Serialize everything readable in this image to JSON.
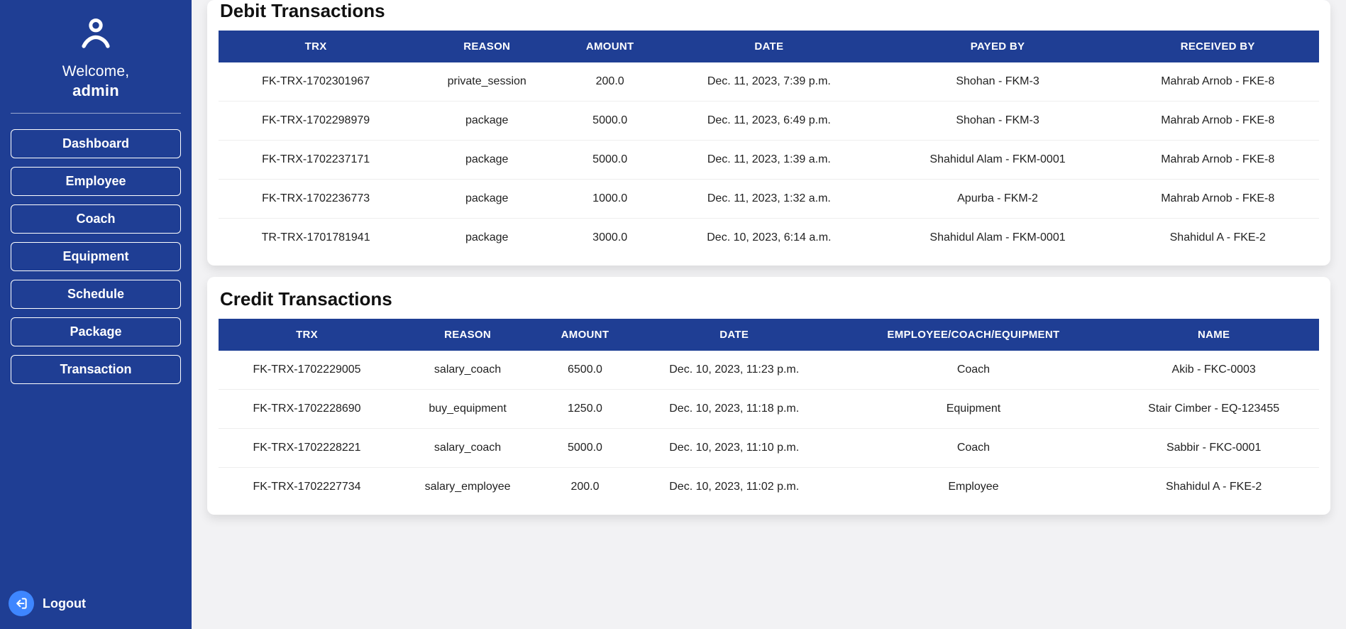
{
  "sidebar": {
    "welcome": "Welcome,",
    "username": "admin",
    "nav": [
      "Dashboard",
      "Employee",
      "Coach",
      "Equipment",
      "Schedule",
      "Package",
      "Transaction"
    ],
    "logout": "Logout"
  },
  "debit": {
    "title": "Debit Transactions",
    "columns": [
      "TRX",
      "REASON",
      "AMOUNT",
      "DATE",
      "PAYED BY",
      "RECEIVED BY"
    ],
    "rows": [
      {
        "trx": "FK-TRX-1702301967",
        "reason": "private_session",
        "amount": "200.0",
        "date": "Dec. 11, 2023, 7:39 p.m.",
        "payed_by": "Shohan - FKM-3",
        "received_by": "Mahrab Arnob - FKE-8"
      },
      {
        "trx": "FK-TRX-1702298979",
        "reason": "package",
        "amount": "5000.0",
        "date": "Dec. 11, 2023, 6:49 p.m.",
        "payed_by": "Shohan - FKM-3",
        "received_by": "Mahrab Arnob - FKE-8"
      },
      {
        "trx": "FK-TRX-1702237171",
        "reason": "package",
        "amount": "5000.0",
        "date": "Dec. 11, 2023, 1:39 a.m.",
        "payed_by": "Shahidul Alam - FKM-0001",
        "received_by": "Mahrab Arnob - FKE-8"
      },
      {
        "trx": "FK-TRX-1702236773",
        "reason": "package",
        "amount": "1000.0",
        "date": "Dec. 11, 2023, 1:32 a.m.",
        "payed_by": "Apurba - FKM-2",
        "received_by": "Mahrab Arnob - FKE-8"
      },
      {
        "trx": "TR-TRX-1701781941",
        "reason": "package",
        "amount": "3000.0",
        "date": "Dec. 10, 2023, 6:14 a.m.",
        "payed_by": "Shahidul Alam - FKM-0001",
        "received_by": "Shahidul A - FKE-2"
      }
    ]
  },
  "credit": {
    "title": "Credit Transactions",
    "columns": [
      "TRX",
      "REASON",
      "AMOUNT",
      "DATE",
      "EMPLOYEE/COACH/EQUIPMENT",
      "NAME"
    ],
    "rows": [
      {
        "trx": "FK-TRX-1702229005",
        "reason": "salary_coach",
        "amount": "6500.0",
        "date": "Dec. 10, 2023, 11:23 p.m.",
        "category": "Coach",
        "name": "Akib - FKC-0003"
      },
      {
        "trx": "FK-TRX-1702228690",
        "reason": "buy_equipment",
        "amount": "1250.0",
        "date": "Dec. 10, 2023, 11:18 p.m.",
        "category": "Equipment",
        "name": "Stair Cimber - EQ-123455"
      },
      {
        "trx": "FK-TRX-1702228221",
        "reason": "salary_coach",
        "amount": "5000.0",
        "date": "Dec. 10, 2023, 11:10 p.m.",
        "category": "Coach",
        "name": "Sabbir - FKC-0001"
      },
      {
        "trx": "FK-TRX-1702227734",
        "reason": "salary_employee",
        "amount": "200.0",
        "date": "Dec. 10, 2023, 11:02 p.m.",
        "category": "Employee",
        "name": "Shahidul A - FKE-2"
      }
    ]
  }
}
